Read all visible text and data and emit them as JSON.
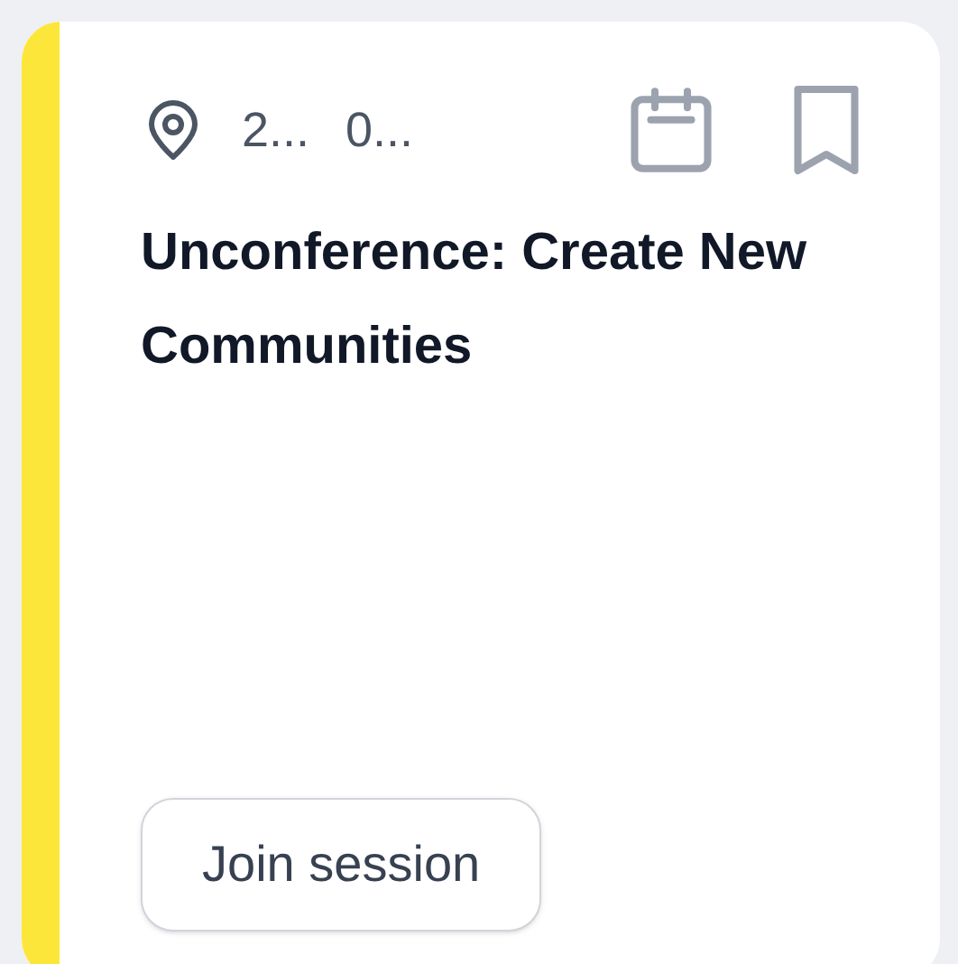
{
  "session": {
    "color": "#fde63a",
    "location": "2...",
    "time": "0...",
    "title": "Unconference: Create New Communities",
    "bookmarked": false,
    "action": "Join session"
  }
}
